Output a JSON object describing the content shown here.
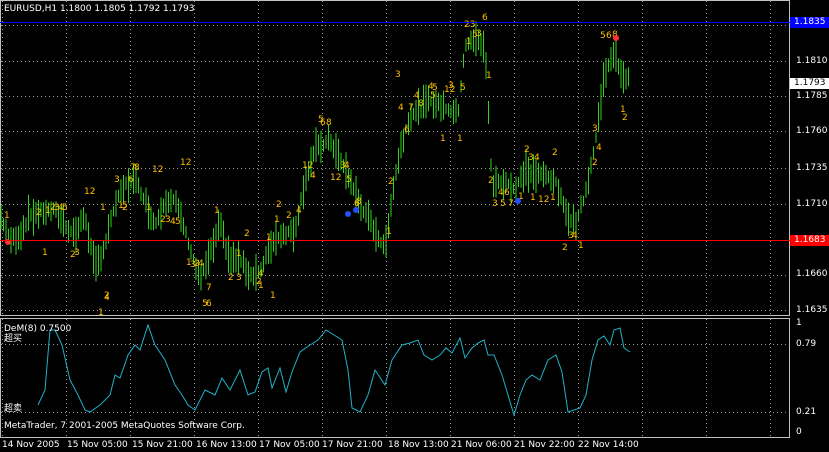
{
  "chart": {
    "title": "EURUSD,H1  1.1800 1.1805 1.1792 1.1793",
    "price_labels": [
      "1.1835",
      "1.1810",
      "1.1785",
      "1.1760",
      "1.1735",
      "1.1710",
      "1.1685",
      "1.1660",
      "1.1635"
    ],
    "current_price": "1.1793",
    "top_line_price": "1.1835",
    "bottom_line_price": "1.1683",
    "colors": {
      "background": "#000000",
      "grid": "#9a9a9a",
      "bars": "#32d21e",
      "price_line_top": "#0000ff",
      "price_line_bottom": "#ff0000",
      "count_labels": "#ffc000",
      "indicator_line": "#20b2c8",
      "text": "#ffffff"
    }
  },
  "indicator": {
    "title": "DeM(8) 0.7500",
    "overbought_label": "超买",
    "oversold_label": "超卖",
    "copyright": "MetaTrader, 7 2001-2005 MetaQuotes Software Corp.",
    "levels": [
      "1",
      "0.79",
      "0.21",
      "0"
    ]
  },
  "time_axis": [
    "14 Nov 2005",
    "15 Nov 05:00",
    "15 Nov 21:00",
    "16 Nov 13:00",
    "17 Nov 05:00",
    "17 Nov 21:00",
    "18 Nov 13:00",
    "21 Nov 06:00",
    "21 Nov 22:00",
    "22 Nov 14:00"
  ]
}
